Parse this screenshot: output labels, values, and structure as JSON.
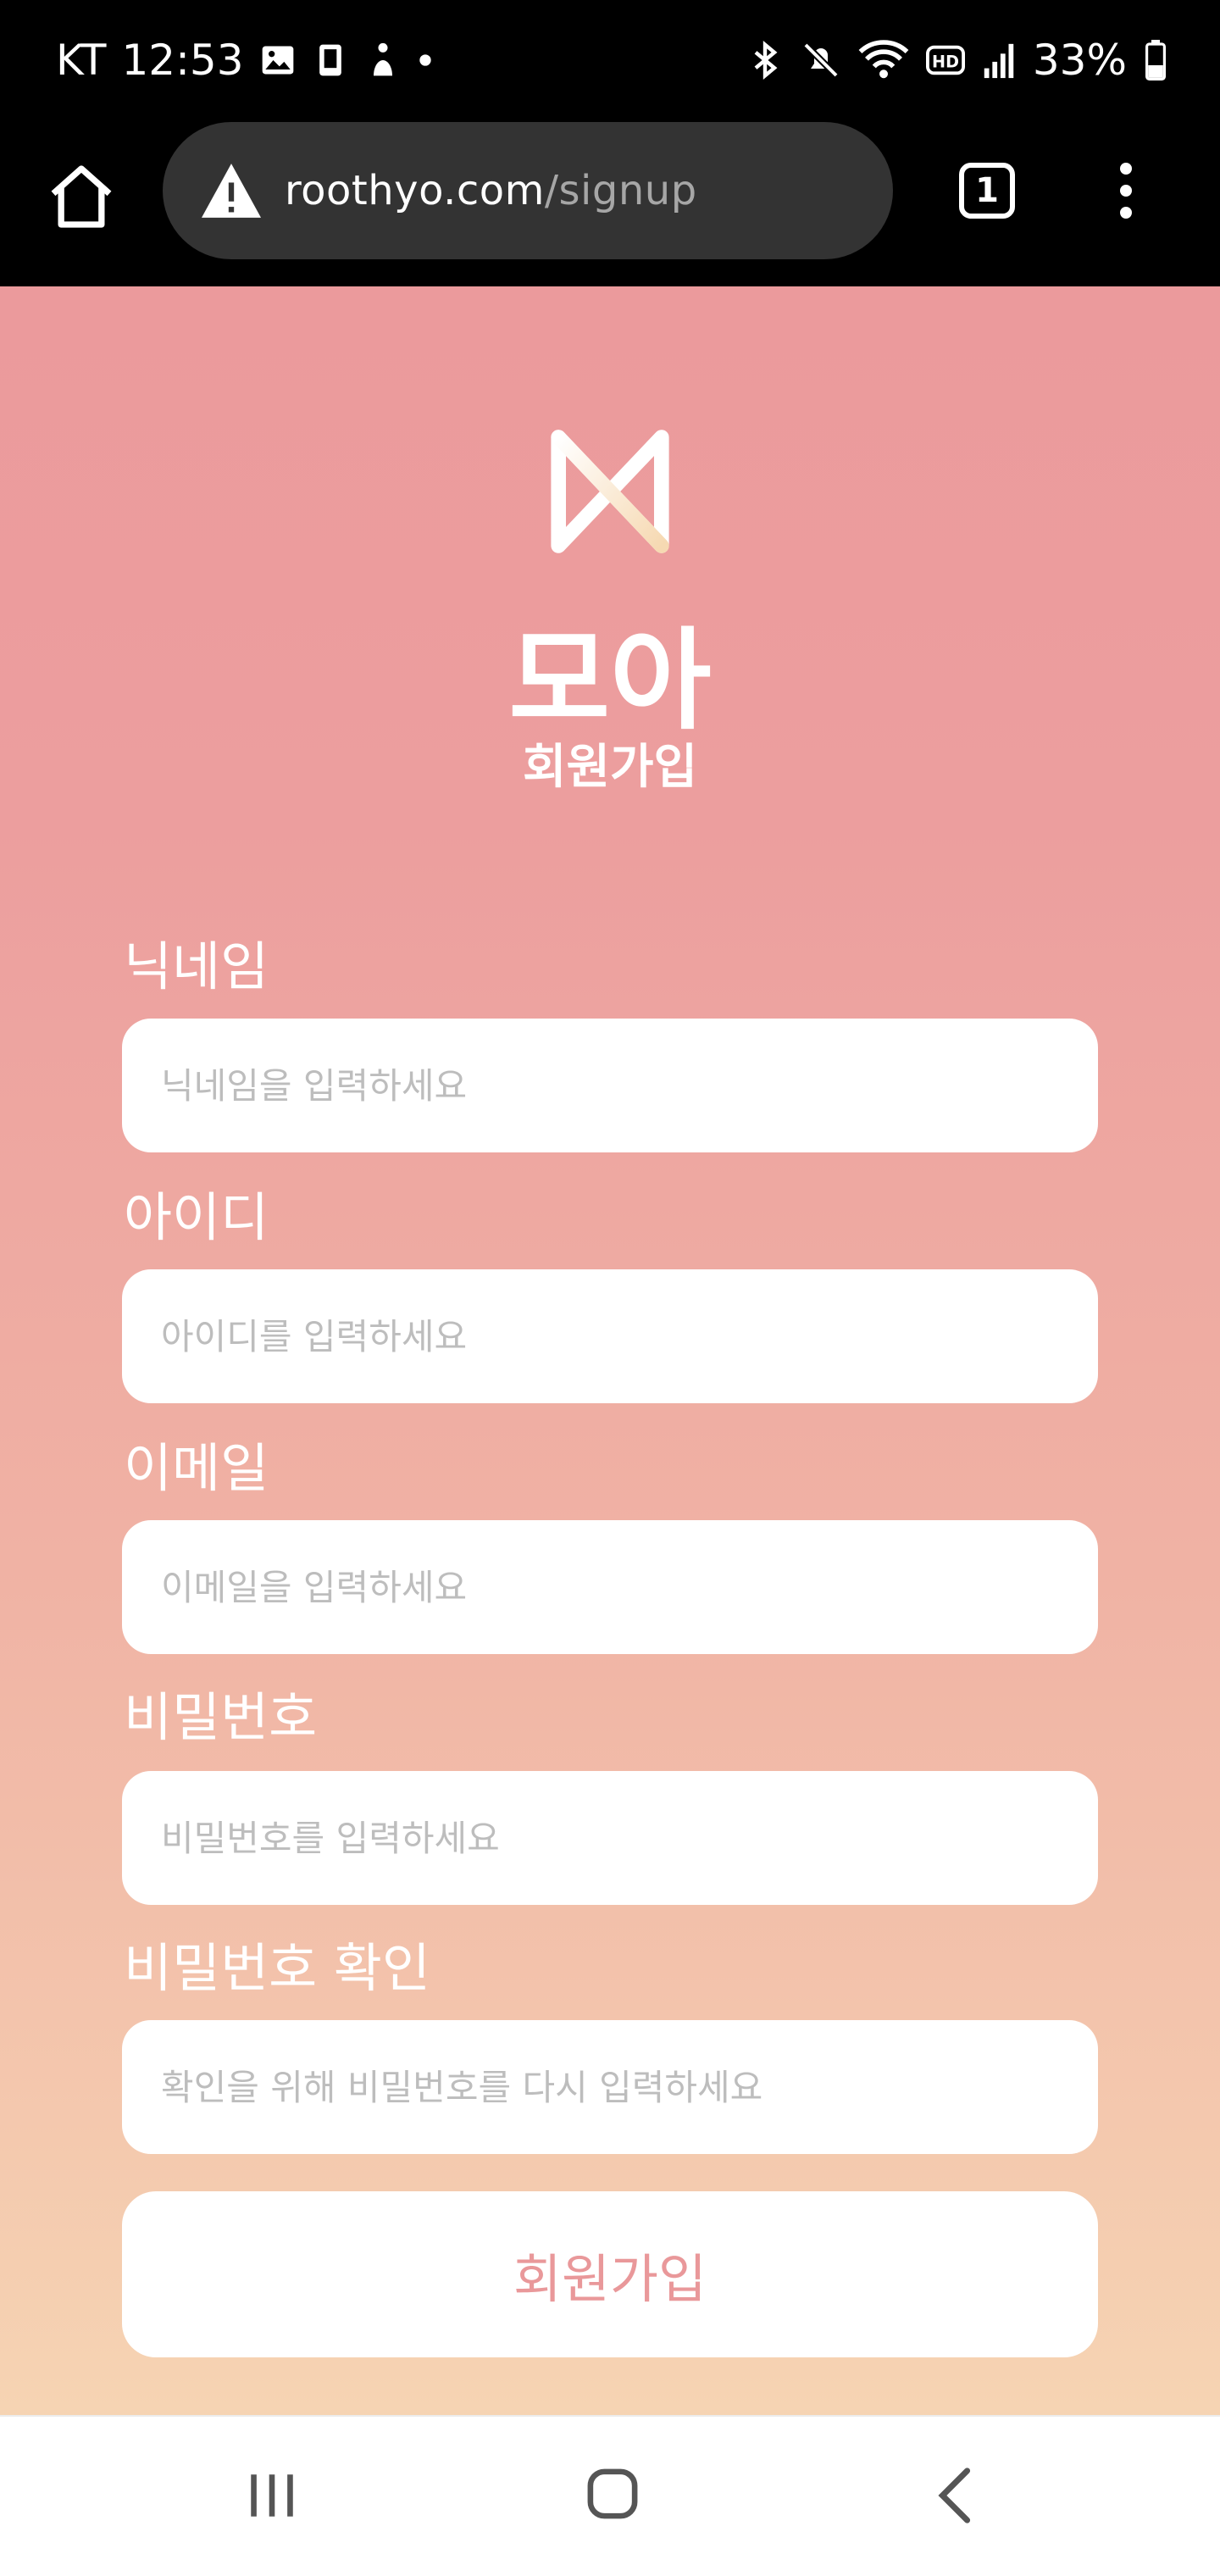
{
  "status_bar": {
    "carrier": "KT",
    "time": "12:53",
    "battery": "33%",
    "notification_icons": [
      "gallery-icon",
      "tablet-icon",
      "accessibility-icon",
      "dot-icon"
    ],
    "system_icons": [
      "bluetooth-icon",
      "mute-icon",
      "wifi-icon",
      "hd-icon",
      "signal-icon",
      "battery-icon"
    ]
  },
  "browser": {
    "url_host": "roothyo.com",
    "url_path": "/signup",
    "tab_count": "1"
  },
  "header": {
    "brand": "모아",
    "subtitle": "회원가입"
  },
  "form": {
    "fields": [
      {
        "label": "닉네임",
        "placeholder": "닉네임을 입력하세요"
      },
      {
        "label": "아이디",
        "placeholder": "아이디를 입력하세요"
      },
      {
        "label": "이메일",
        "placeholder": "이메일을 입력하세요"
      },
      {
        "label": "비밀번호",
        "placeholder": "비밀번호를 입력하세요"
      },
      {
        "label": "비밀번호 확인",
        "placeholder": "확인을 위해 비밀번호를 다시 입력하세요"
      }
    ],
    "submit_label": "회원가입"
  },
  "colors": {
    "gradient_top": "#eb9a9c",
    "gradient_bottom": "#f6d4b3",
    "accent_text": "#e9989a",
    "logo_cream": "#f6d9b2"
  }
}
